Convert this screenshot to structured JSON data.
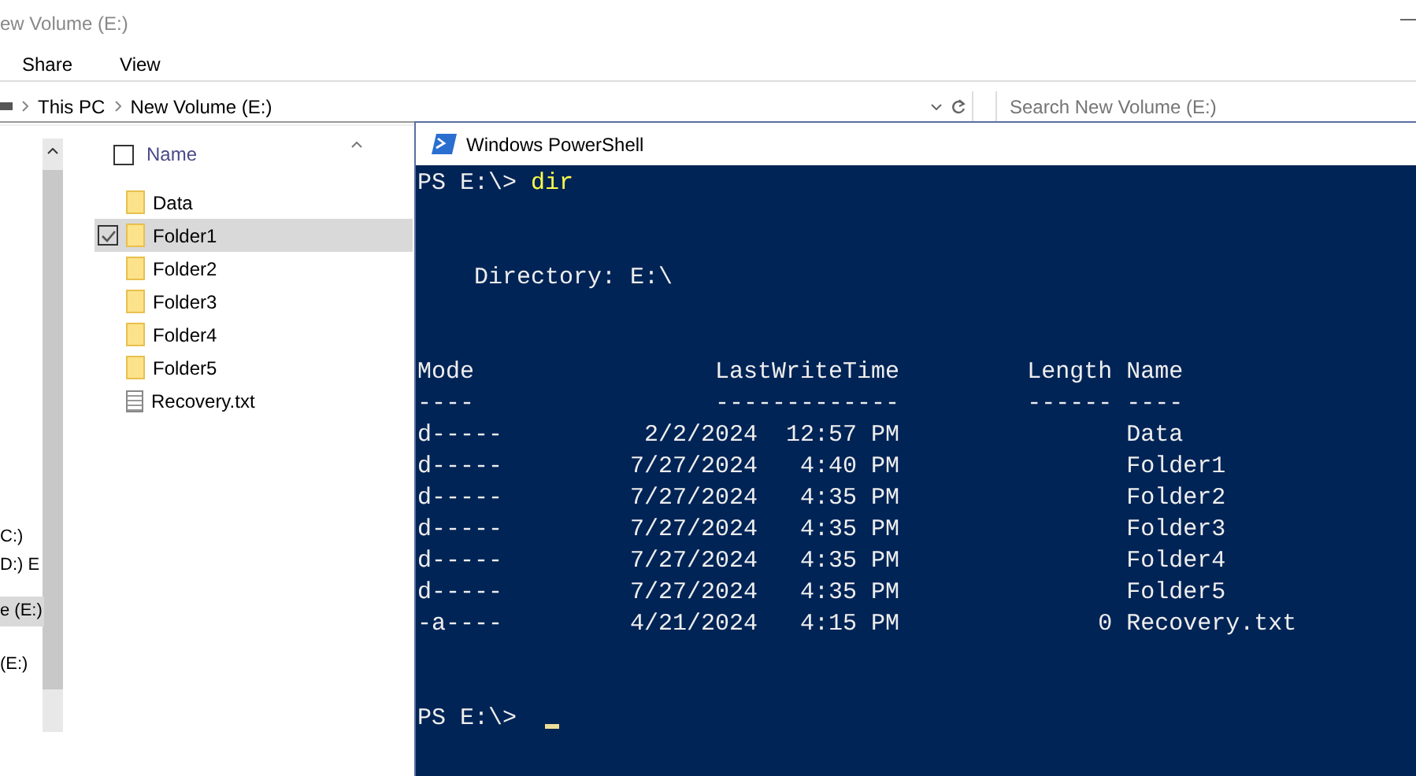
{
  "explorer": {
    "title": "ew Volume (E:)",
    "ribbon_tabs": [
      {
        "label": "Share"
      },
      {
        "label": "View"
      }
    ],
    "breadcrumb": [
      "This PC",
      "New Volume (E:)"
    ],
    "search": {
      "placeholder": "Search New Volume (E:)"
    },
    "nav_items": [
      {
        "label": "C:)",
        "selected": false
      },
      {
        "label": "D:) E",
        "selected": false
      },
      {
        "label": "e (E:)",
        "selected": true
      },
      {
        "label": "(E:)",
        "selected": false
      }
    ],
    "column": "Name",
    "select_all": {
      "checked": false
    },
    "files": [
      {
        "name": "Data",
        "kind": "folder",
        "selected": false
      },
      {
        "name": "Folder1",
        "kind": "folder",
        "selected": true
      },
      {
        "name": "Folder2",
        "kind": "folder",
        "selected": false
      },
      {
        "name": "Folder3",
        "kind": "folder",
        "selected": false
      },
      {
        "name": "Folder4",
        "kind": "folder",
        "selected": false
      },
      {
        "name": "Folder5",
        "kind": "folder",
        "selected": false
      },
      {
        "name": "Recovery.txt",
        "kind": "text",
        "selected": false
      }
    ]
  },
  "powershell": {
    "title": "Windows PowerShell",
    "lines": [
      {
        "kind": "prompt",
        "prompt": "PS E:\\>",
        "command": "dir"
      },
      {
        "kind": "blank"
      },
      {
        "kind": "blank"
      },
      {
        "kind": "text",
        "text": "    Directory: E:\\"
      },
      {
        "kind": "blank"
      },
      {
        "kind": "blank"
      },
      {
        "kind": "text",
        "text": "Mode                 LastWriteTime         Length Name"
      },
      {
        "kind": "text",
        "text": "----                 -------------         ------ ----"
      },
      {
        "kind": "text",
        "text": "d-----          2/2/2024  12:57 PM                Data"
      },
      {
        "kind": "text",
        "text": "d-----         7/27/2024   4:40 PM                Folder1"
      },
      {
        "kind": "text",
        "text": "d-----         7/27/2024   4:35 PM                Folder2"
      },
      {
        "kind": "text",
        "text": "d-----         7/27/2024   4:35 PM                Folder3"
      },
      {
        "kind": "text",
        "text": "d-----         7/27/2024   4:35 PM                Folder4"
      },
      {
        "kind": "text",
        "text": "d-----         7/27/2024   4:35 PM                Folder5"
      },
      {
        "kind": "text",
        "text": "-a----         4/21/2024   4:15 PM              0 Recovery.txt"
      },
      {
        "kind": "blank"
      },
      {
        "kind": "blank"
      },
      {
        "kind": "prompt",
        "prompt": "PS E:\\>",
        "cursor": true
      }
    ]
  }
}
